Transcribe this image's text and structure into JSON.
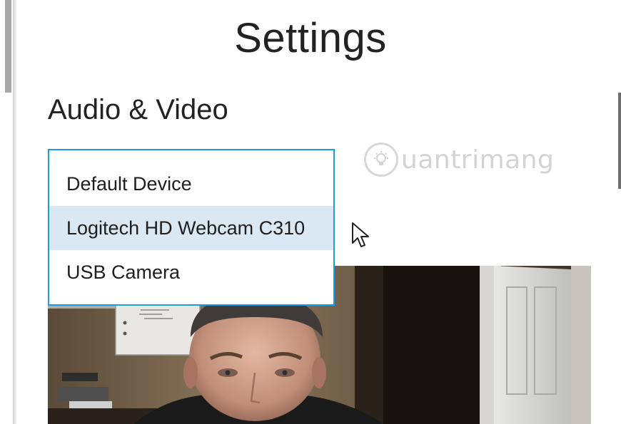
{
  "page": {
    "title": "Settings",
    "section_heading": "Audio & Video"
  },
  "camera_select": {
    "options": [
      {
        "label": "Default Device",
        "selected": false
      },
      {
        "label": "Logitech HD Webcam C310",
        "selected": true
      },
      {
        "label": "USB Camera",
        "selected": false
      }
    ]
  },
  "watermark": {
    "text": "uantrimang"
  },
  "colors": {
    "dropdown_border": "#1b9be0",
    "selected_option_bg": "#d9e8f3",
    "text": "#222222"
  },
  "icons": {
    "cursor": "arrow-cursor-icon",
    "watermark": "lightbulb-logo-icon"
  }
}
